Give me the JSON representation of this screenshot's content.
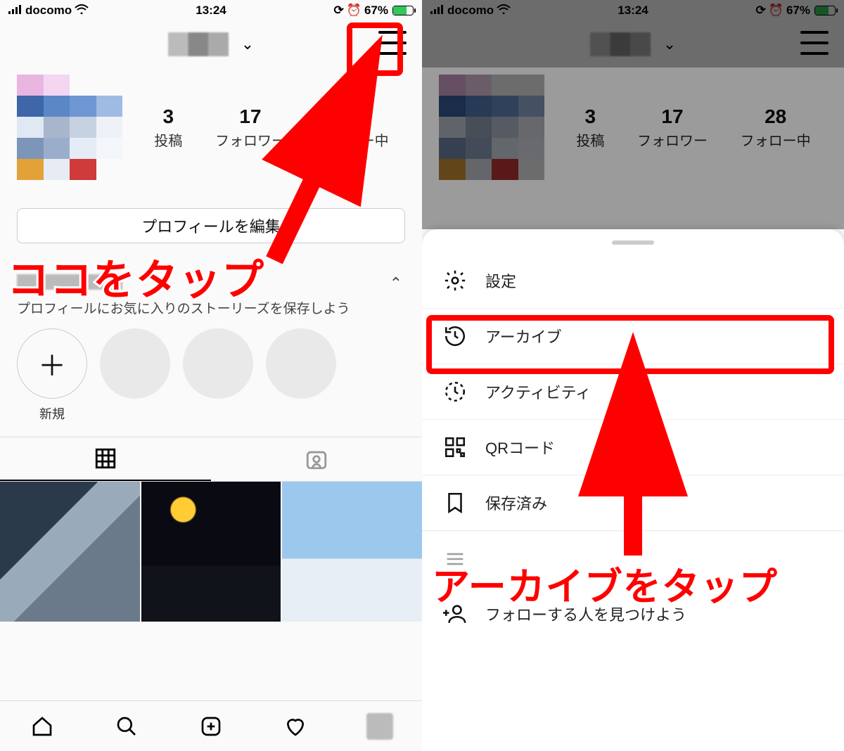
{
  "status": {
    "carrier": "docomo",
    "time": "13:24",
    "battery_pct": "67%"
  },
  "profile": {
    "posts_count": "3",
    "posts_label": "投稿",
    "followers_count": "17",
    "followers_label": "フォロワー",
    "following_count": "28",
    "following_label": "フォロー中",
    "edit_label": "プロフィールを編集",
    "highlight_hint": "プロフィールにお気に入りのストーリーズを保存しよう",
    "highlight_new": "新規"
  },
  "menu": {
    "settings": "設定",
    "archive": "アーカイブ",
    "activity": "アクティビティ",
    "qr": "QRコード",
    "saved": "保存済み",
    "discover": "フォローする人を見つけよう"
  },
  "annotations": {
    "tap_here": "ココをタップ",
    "tap_archive": "アーカイブをタップ"
  }
}
